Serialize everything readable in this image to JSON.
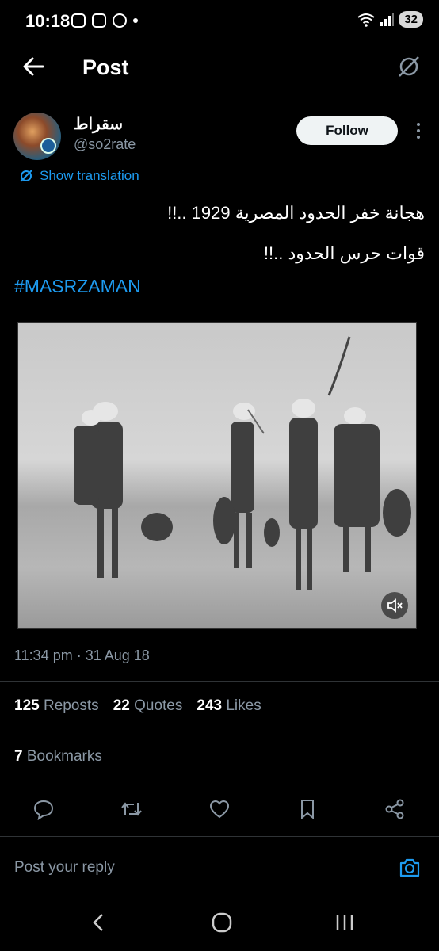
{
  "status_bar": {
    "time": "10:18",
    "battery": "32"
  },
  "header": {
    "title": "Post"
  },
  "author": {
    "display_name": "سقراط",
    "handle": "@so2rate",
    "follow_label": "Follow"
  },
  "translate_label": "Show translation",
  "post": {
    "line1": "هجانة خفر الحدود المصرية 1929 ..!!",
    "line2": "قوات حرس الحدود ..!!",
    "hashtag": "#MASRZAMAN",
    "timestamp": "11:34 pm · 31 Aug 18"
  },
  "stats": {
    "reposts_count": "125",
    "reposts_label": "Reposts",
    "quotes_count": "22",
    "quotes_label": "Quotes",
    "likes_count": "243",
    "likes_label": "Likes",
    "bookmarks_count": "7",
    "bookmarks_label": "Bookmarks"
  },
  "reply": {
    "placeholder": "Post your reply"
  },
  "colors": {
    "accent": "#1d9bf0",
    "muted": "#8b98a5",
    "background": "#000000"
  }
}
